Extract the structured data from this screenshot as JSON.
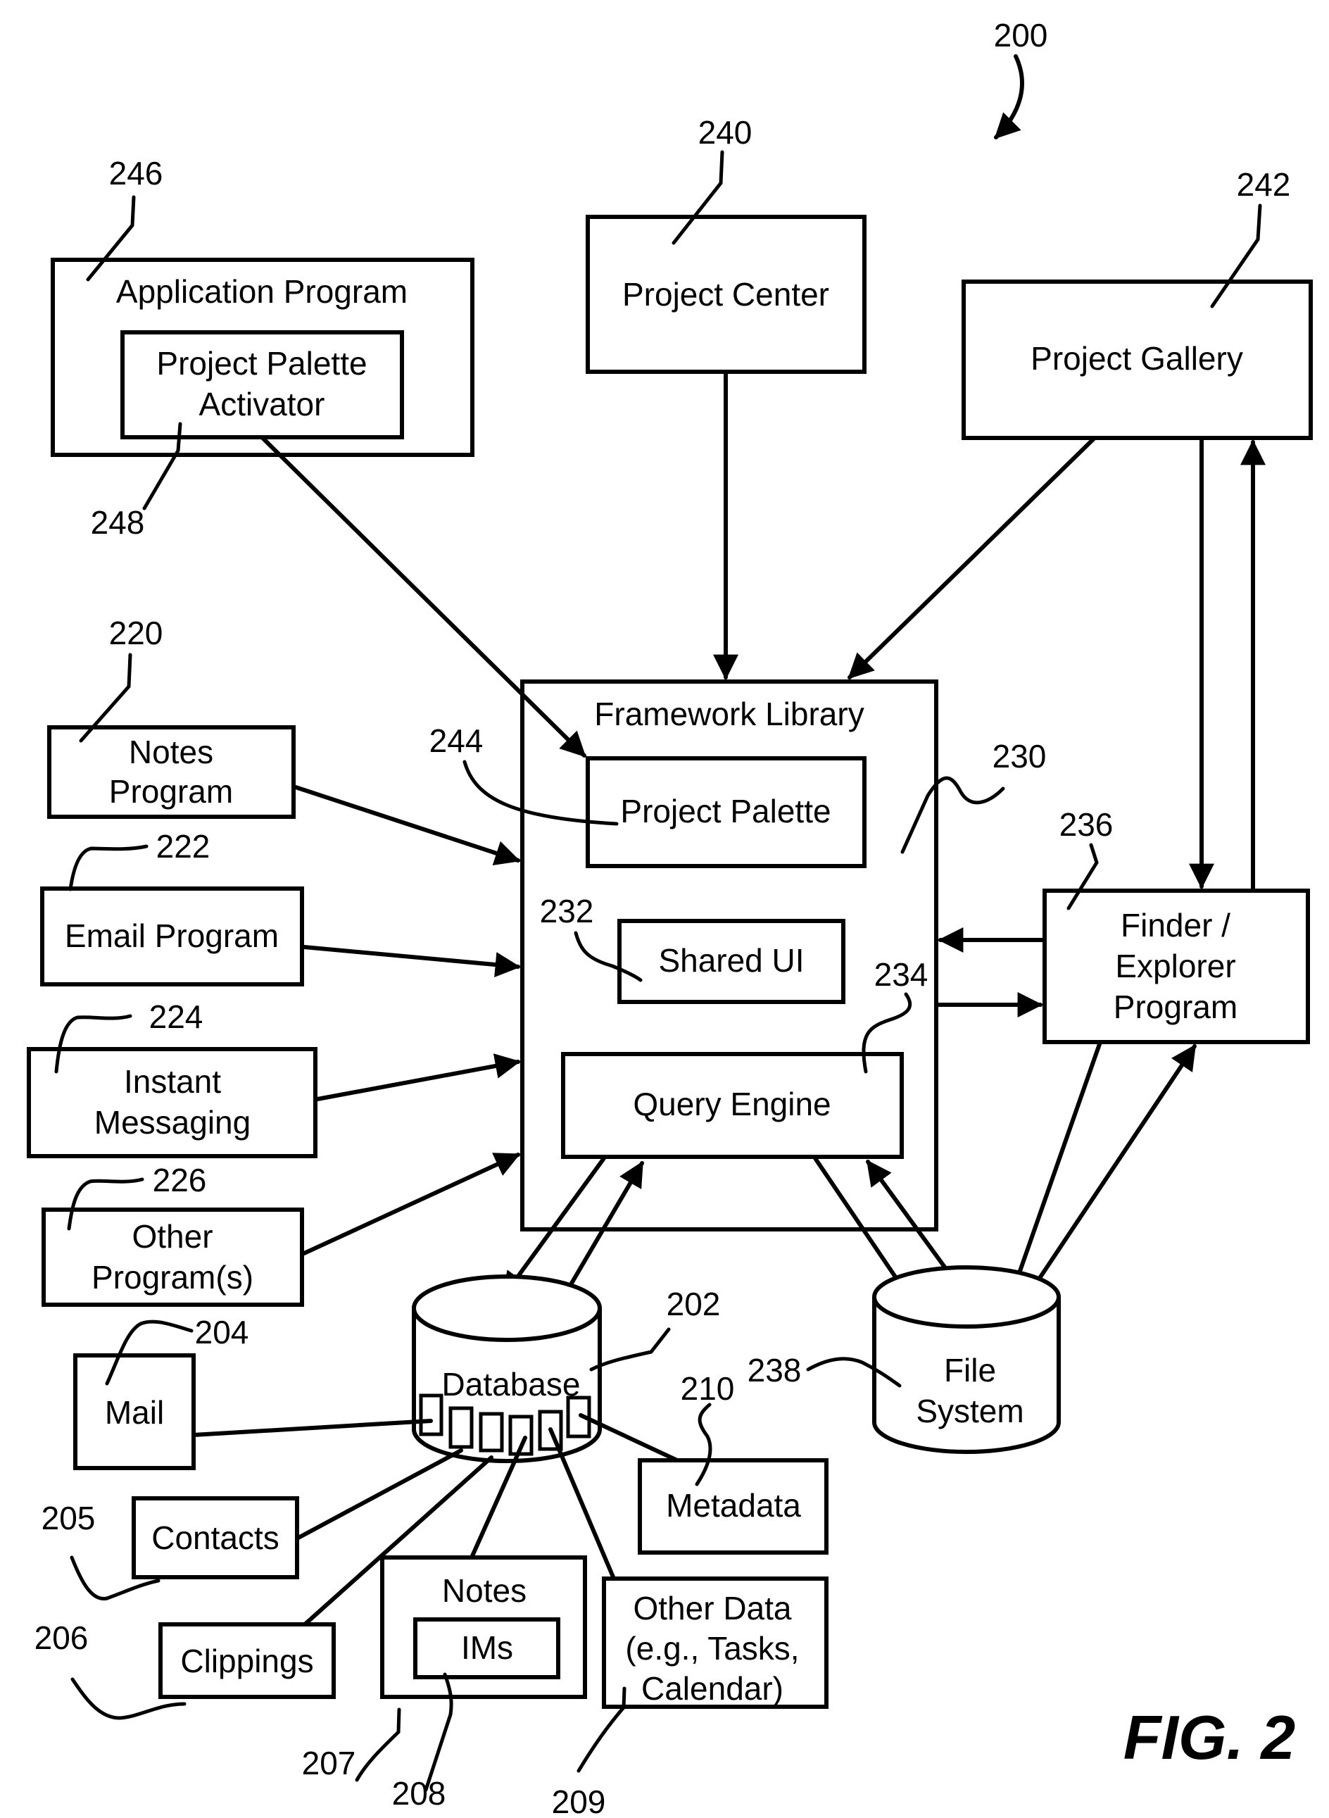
{
  "figure": {
    "label": "FIG. 2",
    "system_ref": "200"
  },
  "nodes": {
    "application_program": {
      "ref": "246",
      "lines": [
        "Application Program"
      ]
    },
    "project_palette_activator": {
      "ref": "248",
      "lines": [
        "Project Palette",
        "Activator"
      ]
    },
    "project_center": {
      "ref": "240",
      "lines": [
        "Project Center"
      ]
    },
    "project_gallery": {
      "ref": "242",
      "lines": [
        "Project Gallery"
      ]
    },
    "framework_library": {
      "ref": "230",
      "lines": [
        "Framework Library"
      ]
    },
    "project_palette": {
      "ref": "244",
      "lines": [
        "Project Palette"
      ]
    },
    "shared_ui": {
      "ref": "232",
      "lines": [
        "Shared UI"
      ]
    },
    "query_engine": {
      "ref": "234",
      "lines": [
        "Query Engine"
      ]
    },
    "finder_explorer": {
      "ref": "236",
      "lines": [
        "Finder /",
        "Explorer",
        "Program"
      ]
    },
    "notes_program": {
      "ref": "220",
      "lines": [
        "Notes",
        "Program"
      ]
    },
    "email_program": {
      "ref": "222",
      "lines": [
        "Email Program"
      ]
    },
    "instant_messaging": {
      "ref": "224",
      "lines": [
        "Instant",
        "Messaging"
      ]
    },
    "other_programs": {
      "ref": "226",
      "lines": [
        "Other",
        "Program(s)"
      ]
    },
    "database": {
      "ref": "202",
      "lines": [
        "Database"
      ]
    },
    "file_system": {
      "ref": "238",
      "lines": [
        "File",
        "System"
      ]
    },
    "mail": {
      "ref": "204",
      "lines": [
        "Mail"
      ]
    },
    "contacts": {
      "ref": "205",
      "lines": [
        "Contacts"
      ]
    },
    "clippings": {
      "ref": "206",
      "lines": [
        "Clippings"
      ]
    },
    "notes_data": {
      "ref": "207",
      "lines": [
        "Notes"
      ]
    },
    "ims": {
      "ref": "208",
      "lines": [
        "IMs"
      ]
    },
    "other_data": {
      "ref": "209",
      "lines": [
        "Other Data",
        "(e.g., Tasks,",
        "Calendar)"
      ]
    },
    "metadata": {
      "ref": "210",
      "lines": [
        "Metadata"
      ]
    }
  },
  "edges": [
    {
      "from": "project_palette_activator",
      "to": "project_palette",
      "arrow": "to"
    },
    {
      "from": "project_center",
      "to": "framework_library",
      "arrow": "to"
    },
    {
      "from": "project_gallery",
      "to": "framework_library",
      "arrow": "to"
    },
    {
      "from": "project_gallery",
      "to": "finder_explorer",
      "arrow": "to"
    },
    {
      "from": "finder_explorer",
      "to": "project_gallery",
      "arrow": "to"
    },
    {
      "from": "notes_program",
      "to": "framework_library",
      "arrow": "to"
    },
    {
      "from": "email_program",
      "to": "framework_library",
      "arrow": "to"
    },
    {
      "from": "instant_messaging",
      "to": "framework_library",
      "arrow": "to"
    },
    {
      "from": "other_programs",
      "to": "framework_library",
      "arrow": "to"
    },
    {
      "from": "finder_explorer",
      "to": "framework_library",
      "arrow": "to"
    },
    {
      "from": "framework_library",
      "to": "finder_explorer",
      "arrow": "to"
    },
    {
      "from": "query_engine",
      "to": "database",
      "arrow": "to"
    },
    {
      "from": "database",
      "to": "query_engine",
      "arrow": "to"
    },
    {
      "from": "query_engine",
      "to": "file_system",
      "arrow": "to"
    },
    {
      "from": "file_system",
      "to": "query_engine",
      "arrow": "to"
    },
    {
      "from": "finder_explorer",
      "to": "file_system",
      "arrow": "to"
    },
    {
      "from": "file_system",
      "to": "finder_explorer",
      "arrow": "to"
    },
    {
      "from": "mail",
      "to": "database",
      "arrow": "none"
    },
    {
      "from": "contacts",
      "to": "database",
      "arrow": "none"
    },
    {
      "from": "clippings",
      "to": "database",
      "arrow": "none"
    },
    {
      "from": "notes_data",
      "to": "database",
      "arrow": "none"
    },
    {
      "from": "other_data",
      "to": "database",
      "arrow": "none"
    },
    {
      "from": "metadata",
      "to": "database",
      "arrow": "none"
    }
  ]
}
